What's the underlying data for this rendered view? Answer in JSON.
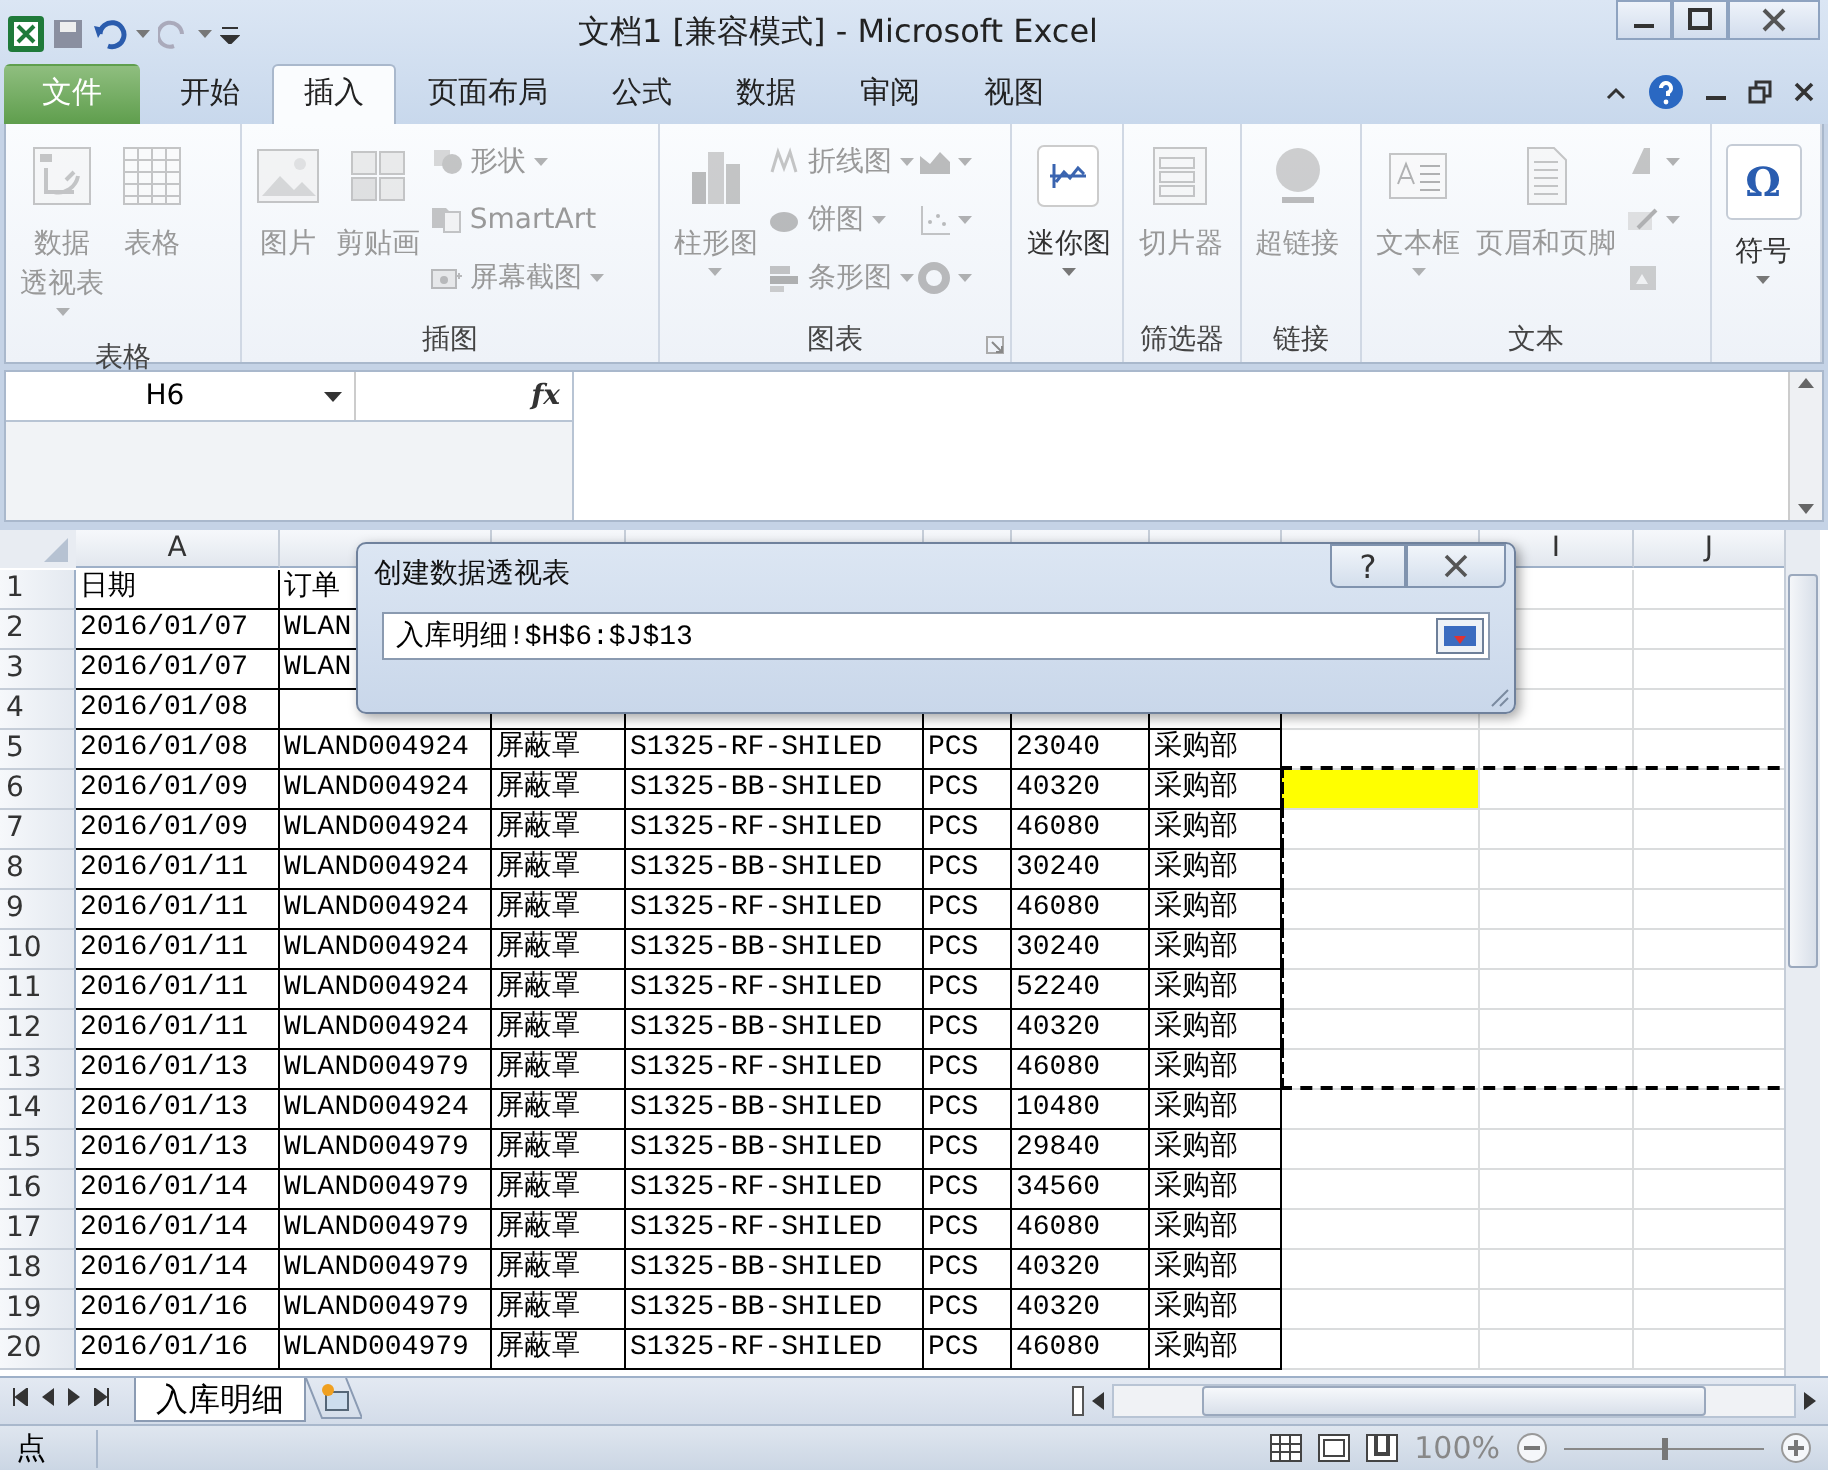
{
  "window": {
    "title": "文档1  [兼容模式]  -  Microsoft Excel"
  },
  "tabs": [
    {
      "label": "文件",
      "kind": "file",
      "selected": false
    },
    {
      "label": "开始",
      "kind": "tab",
      "selected": false
    },
    {
      "label": "插入",
      "kind": "tab",
      "selected": true
    },
    {
      "label": "页面布局",
      "kind": "tab",
      "selected": false
    },
    {
      "label": "公式",
      "kind": "tab",
      "selected": false
    },
    {
      "label": "数据",
      "kind": "tab",
      "selected": false
    },
    {
      "label": "审阅",
      "kind": "tab",
      "selected": false
    },
    {
      "label": "视图",
      "kind": "tab",
      "selected": false
    }
  ],
  "ribbon": {
    "groups": [
      {
        "label": "表格",
        "launcher": false,
        "items": [
          {
            "kind": "large",
            "lines": [
              "数据",
              "透视表"
            ],
            "dropdown": true,
            "disabled": true
          },
          {
            "kind": "large",
            "lines": [
              "表格"
            ],
            "dropdown": false,
            "disabled": true
          }
        ]
      },
      {
        "label": "插图",
        "launcher": false,
        "items": [
          {
            "kind": "large",
            "lines": [
              "图片"
            ],
            "dropdown": false,
            "disabled": true
          },
          {
            "kind": "large",
            "lines": [
              "剪贴画"
            ],
            "dropdown": false,
            "disabled": true
          },
          {
            "kind": "small",
            "lines": [
              "形状"
            ],
            "dropdown": true,
            "disabled": true
          },
          {
            "kind": "small",
            "lines": [
              "SmartArt"
            ],
            "dropdown": false,
            "disabled": true
          },
          {
            "kind": "small",
            "lines": [
              "屏幕截图"
            ],
            "dropdown": true,
            "disabled": true
          }
        ]
      },
      {
        "label": "图表",
        "launcher": true,
        "items": [
          {
            "kind": "large",
            "lines": [
              "柱形图"
            ],
            "dropdown": true,
            "disabled": true
          },
          {
            "kind": "small",
            "lines": [
              "折线图"
            ],
            "dropdown": true,
            "disabled": true
          },
          {
            "kind": "small",
            "lines": [
              "饼图"
            ],
            "dropdown": true,
            "disabled": true
          },
          {
            "kind": "small",
            "lines": [
              "条形图"
            ],
            "dropdown": true,
            "disabled": true
          },
          {
            "kind": "icon",
            "dropdown": true,
            "disabled": true
          },
          {
            "kind": "icon",
            "dropdown": true,
            "disabled": true
          },
          {
            "kind": "icon",
            "dropdown": true,
            "disabled": true
          }
        ]
      },
      {
        "launcher": false,
        "items": [
          {
            "kind": "large",
            "lines": [
              "迷你图"
            ],
            "dropdown": true,
            "disabled": false
          }
        ]
      },
      {
        "label": "筛选器",
        "launcher": false,
        "items": [
          {
            "kind": "large",
            "lines": [
              "切片器"
            ],
            "dropdown": false,
            "disabled": true
          }
        ]
      },
      {
        "label": "链接",
        "launcher": false,
        "items": [
          {
            "kind": "large",
            "lines": [
              "超链接"
            ],
            "dropdown": false,
            "disabled": true
          }
        ]
      },
      {
        "label": "文本",
        "launcher": false,
        "items": [
          {
            "kind": "large",
            "lines": [
              "文本框"
            ],
            "dropdown": true,
            "disabled": true
          },
          {
            "kind": "large",
            "lines": [
              "页眉和页脚"
            ],
            "dropdown": false,
            "disabled": true
          },
          {
            "kind": "icon",
            "dropdown": true,
            "disabled": true
          },
          {
            "kind": "icon",
            "dropdown": true,
            "disabled": true
          },
          {
            "kind": "icon",
            "dropdown": false,
            "disabled": true
          }
        ]
      },
      {
        "launcher": false,
        "items": [
          {
            "kind": "large",
            "lines": [
              "符号"
            ],
            "glyph": "Ω",
            "dropdown": true,
            "disabled": false
          }
        ]
      }
    ]
  },
  "formula_bar": {
    "name_box": "H6",
    "function_label": "fx"
  },
  "sheet": {
    "columns": [
      "A",
      null,
      null,
      null,
      null,
      null,
      null,
      null,
      "I",
      "J"
    ],
    "rows": [
      {
        "number": "1",
        "cells": [
          "日期",
          "订单"
        ],
        "highlight": false,
        "in_range": false
      },
      {
        "number": "2",
        "cells": [
          "2016/01/07",
          "WLAN"
        ],
        "highlight": false,
        "in_range": false
      },
      {
        "number": "3",
        "cells": [
          "2016/01/07",
          "WLAN"
        ],
        "highlight": false,
        "in_range": false
      },
      {
        "number": "4",
        "cells": [
          "2016/01/08"
        ],
        "highlight": false,
        "in_range": false
      },
      {
        "number": "5",
        "cells": [
          "2016/01/08",
          "WLAND004924",
          "屏蔽罩",
          "S1325-RF-SHILED",
          "PCS",
          "23040",
          "采购部"
        ],
        "highlight": false,
        "in_range": false
      },
      {
        "number": "6",
        "cells": [
          "2016/01/09",
          "WLAND004924",
          "屏蔽罩",
          "S1325-BB-SHILED",
          "PCS",
          "40320",
          "采购部"
        ],
        "highlight": true,
        "in_range": true
      },
      {
        "number": "7",
        "cells": [
          "2016/01/09",
          "WLAND004924",
          "屏蔽罩",
          "S1325-RF-SHILED",
          "PCS",
          "46080",
          "采购部"
        ],
        "highlight": false,
        "in_range": true
      },
      {
        "number": "8",
        "cells": [
          "2016/01/11",
          "WLAND004924",
          "屏蔽罩",
          "S1325-BB-SHILED",
          "PCS",
          "30240",
          "采购部"
        ],
        "highlight": false,
        "in_range": true
      },
      {
        "number": "9",
        "cells": [
          "2016/01/11",
          "WLAND004924",
          "屏蔽罩",
          "S1325-RF-SHILED",
          "PCS",
          "46080",
          "采购部"
        ],
        "highlight": false,
        "in_range": true
      },
      {
        "number": "10",
        "cells": [
          "2016/01/11",
          "WLAND004924",
          "屏蔽罩",
          "S1325-BB-SHILED",
          "PCS",
          "30240",
          "采购部"
        ],
        "highlight": false,
        "in_range": true
      },
      {
        "number": "11",
        "cells": [
          "2016/01/11",
          "WLAND004924",
          "屏蔽罩",
          "S1325-RF-SHILED",
          "PCS",
          "52240",
          "采购部"
        ],
        "highlight": false,
        "in_range": true
      },
      {
        "number": "12",
        "cells": [
          "2016/01/11",
          "WLAND004924",
          "屏蔽罩",
          "S1325-BB-SHILED",
          "PCS",
          "40320",
          "采购部"
        ],
        "highlight": false,
        "in_range": true
      },
      {
        "number": "13",
        "cells": [
          "2016/01/13",
          "WLAND004979",
          "屏蔽罩",
          "S1325-RF-SHILED",
          "PCS",
          "46080",
          "采购部"
        ],
        "highlight": false,
        "in_range": true
      },
      {
        "number": "14",
        "cells": [
          "2016/01/13",
          "WLAND004924",
          "屏蔽罩",
          "S1325-BB-SHILED",
          "PCS",
          "10480",
          "采购部"
        ],
        "highlight": false,
        "in_range": false
      },
      {
        "number": "15",
        "cells": [
          "2016/01/13",
          "WLAND004979",
          "屏蔽罩",
          "S1325-BB-SHILED",
          "PCS",
          "29840",
          "采购部"
        ],
        "highlight": false,
        "in_range": false
      },
      {
        "number": "16",
        "cells": [
          "2016/01/14",
          "WLAND004979",
          "屏蔽罩",
          "S1325-RF-SHILED",
          "PCS",
          "34560",
          "采购部"
        ],
        "highlight": false,
        "in_range": false
      },
      {
        "number": "17",
        "cells": [
          "2016/01/14",
          "WLAND004979",
          "屏蔽罩",
          "S1325-RF-SHILED",
          "PCS",
          "46080",
          "采购部"
        ],
        "highlight": false,
        "in_range": false
      },
      {
        "number": "18",
        "cells": [
          "2016/01/14",
          "WLAND004979",
          "屏蔽罩",
          "S1325-BB-SHILED",
          "PCS",
          "40320",
          "采购部"
        ],
        "highlight": false,
        "in_range": false
      },
      {
        "number": "19",
        "cells": [
          "2016/01/16",
          "WLAND004979",
          "屏蔽罩",
          "S1325-BB-SHILED",
          "PCS",
          "40320",
          "采购部"
        ],
        "highlight": false,
        "in_range": false
      },
      {
        "number": "20",
        "cells": [
          "2016/01/16",
          "WLAND004979",
          "屏蔽罩",
          "S1325-RF-SHILED",
          "PCS",
          "46080",
          "采购部"
        ],
        "highlight": false,
        "in_range": false
      }
    ]
  },
  "dialog": {
    "title": "创建数据透视表",
    "help": "?",
    "range": "入库明细!$H$6:$J$13"
  },
  "sheet_tabs": [
    {
      "label": "入库明细",
      "selected": true
    }
  ],
  "status_bar": {
    "mode": "点",
    "zoom": "100%",
    "zoom_slider": {
      "level": 0.5
    }
  }
}
